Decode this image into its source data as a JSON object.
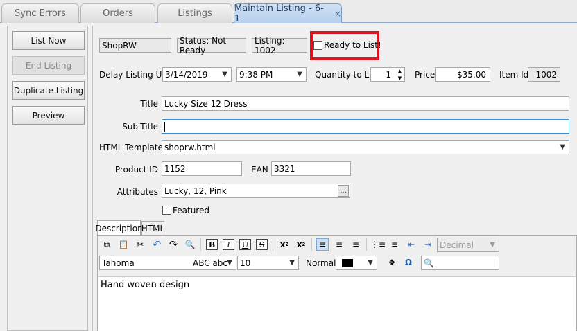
{
  "tabs": [
    {
      "label": "Sync Errors"
    },
    {
      "label": "Orders"
    },
    {
      "label": "Listings"
    },
    {
      "label": "Maintain Listing - 6-1",
      "close": "×"
    }
  ],
  "actions": {
    "list_now": "List Now",
    "end_listing": "End Listing",
    "duplicate_listing": "Duplicate Listing",
    "preview": "Preview"
  },
  "header": {
    "store": "ShopRW",
    "status": "Status: Not Ready",
    "listing": "Listing: 1002",
    "ready_label": "Ready to List!",
    "ready_checked": false
  },
  "schedule": {
    "delay_label": "Delay Listing Until",
    "date": "3/14/2019",
    "time": "9:38 PM",
    "quantity_label": "Quantity to List",
    "quantity": "1",
    "price_label": "Price",
    "price": "$35.00",
    "item_id_label": "Item Id",
    "item_id": "1002"
  },
  "form": {
    "title_label": "Title",
    "title": "Lucky Size 12 Dress",
    "subtitle_label": "Sub-Title",
    "subtitle": "",
    "template_label": "HTML Template",
    "template": "shoprw.html",
    "product_id_label": "Product ID",
    "product_id": "1152",
    "ean_label": "EAN",
    "ean": "3321",
    "attributes_label": "Attributes",
    "attributes": "Lucky, 12, Pink",
    "ellipsis": "...",
    "featured_label": "Featured",
    "featured_checked": false
  },
  "editor": {
    "tabs": [
      "Description",
      "HTML"
    ],
    "font": "Tahoma",
    "font_preview": "ABC abc",
    "size": "10",
    "style": "Normal",
    "number_format": "Decimal",
    "text_color": "#000000",
    "content": "Hand woven design"
  },
  "colors": {
    "highlight": "#e0141e",
    "active_tab": "#b7d0ee",
    "focus": "#3f8fd3"
  }
}
